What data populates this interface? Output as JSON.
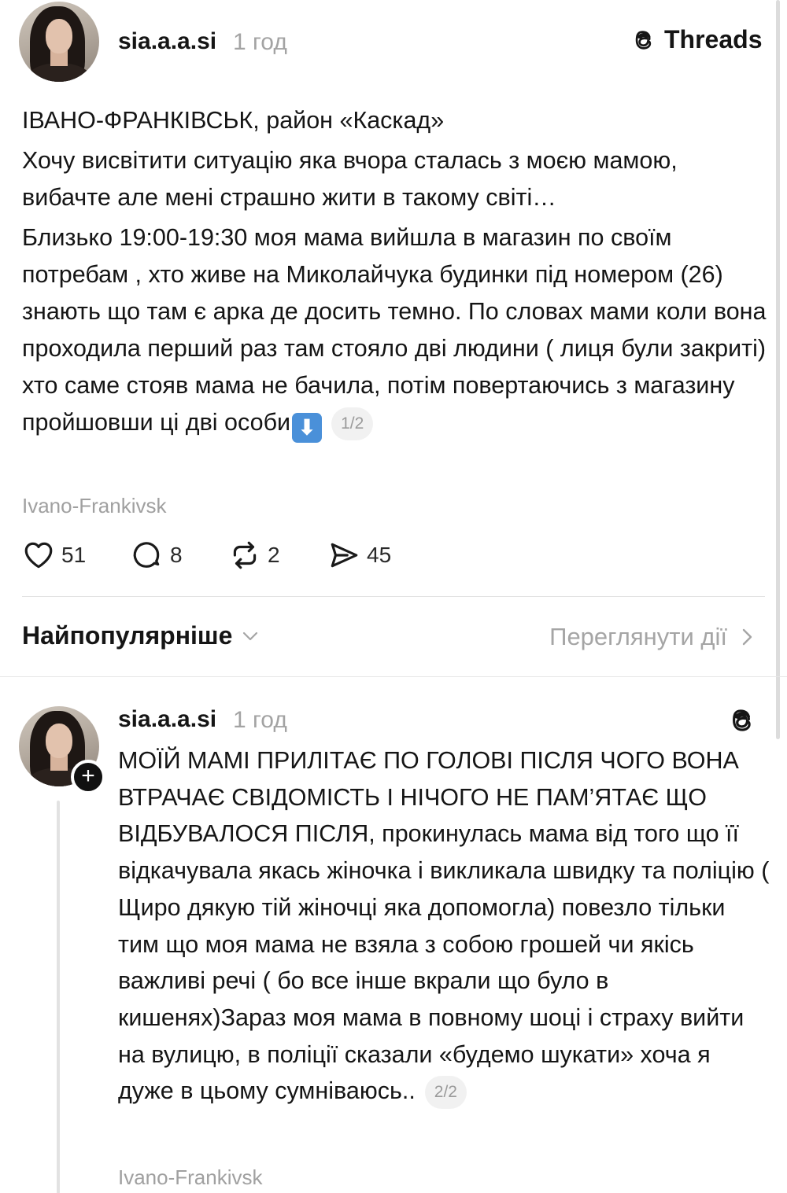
{
  "post": {
    "username": "sia.a.a.si",
    "time": "1 год",
    "brand": "Threads",
    "paragraphs": [
      "ІВАНО-ФРАНКІВСЬК, район «Каскад»",
      "Хочу висвітити ситуацію яка вчора сталась з моєю мамою, вибачте але мені страшно жити в такому світі…",
      "Близько 19:00-19:30 моя мама вийшла в магазин по своїм потребам , хто живе на Миколайчука будинки під номером (26) знають що там є арка де досить темно. По словах мами коли вона проходила перший раз там стояло дві людини ( лиця були закриті) хто саме стояв мама не бачила, потім повертаючись з магазину пройшовши ці дві особи"
    ],
    "arrow_emoji": "⬇",
    "page_counter": "1/2",
    "location": "Ivano-Frankivsk",
    "likes": "51",
    "comments": "8",
    "reposts": "2",
    "shares": "45"
  },
  "sort": {
    "label": "Найпопулярніше",
    "view_activity": "Переглянути дії"
  },
  "reply": {
    "username": "sia.a.a.si",
    "time": "1 год",
    "text": "МОЇЙ МАМІ ПРИЛІТАЄ ПО ГОЛОВІ ПІСЛЯ ЧОГО ВОНА ВТРАЧАЄ СВІДОМІСТЬ І НІЧОГО НЕ ПАМ’ЯТАЄ ЩО ВІДБУВАЛОСЯ ПІСЛЯ, прокинулась мама від того що її відкачувала якась жіночка і викликала швидку та поліцію ( Щиро дякую тій жіночці яка допомогла) повезло тільки тим що моя мама не взяла з собою грошей чи якісь важливі речі ( бо все інше вкрали що було в кишенях)Зараз моя мама в повному шоці і страху вийти на вулицю, в поліції сказали «будемо шукати» хоча я дуже в цьому сумніваюсь..",
    "page_counter": "2/2",
    "location": "Ivano-Frankivsk",
    "follow_icon": "plus-icon"
  },
  "colors": {
    "text": "#151515",
    "muted": "#a3a3a3",
    "divider": "#e3e3e3",
    "emoji_blue": "#4a90d9"
  }
}
